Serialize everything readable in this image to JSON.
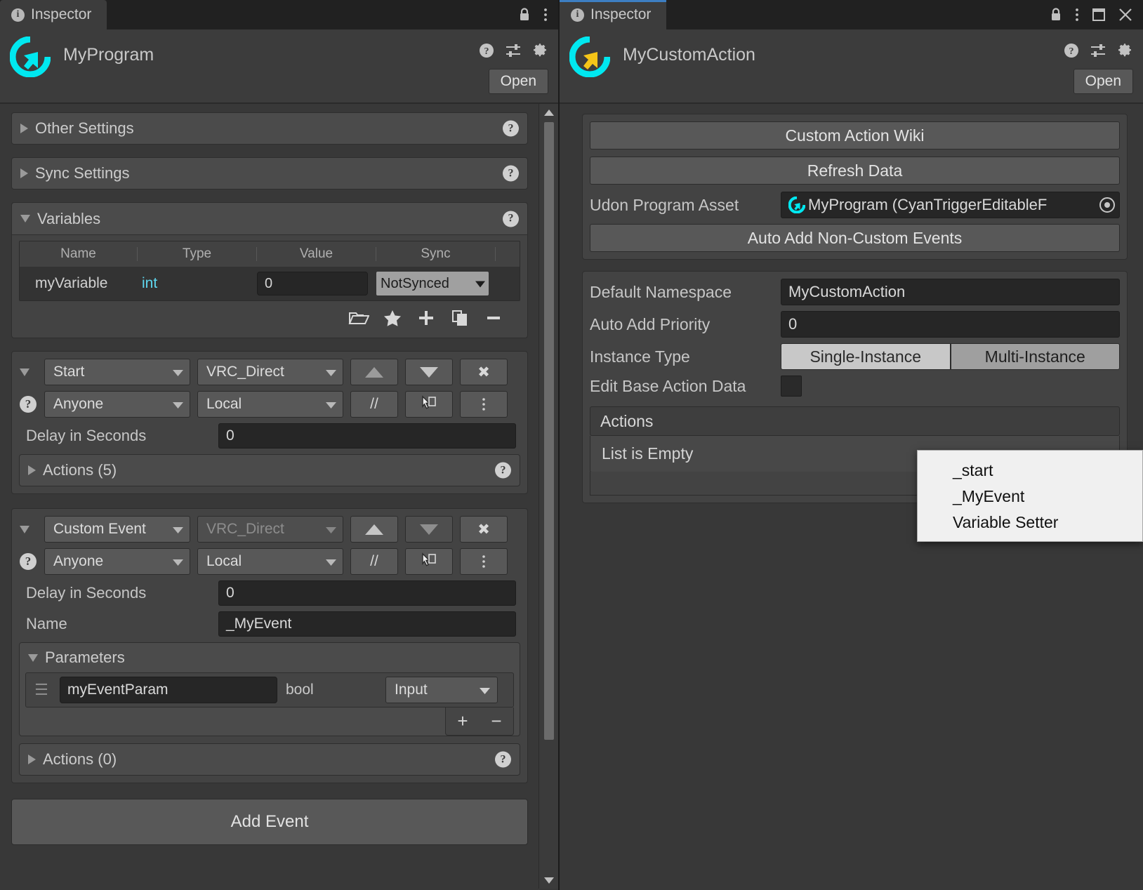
{
  "left_panel": {
    "tab": {
      "label": "Inspector",
      "icon": "info-icon"
    },
    "tabbar_icons": [
      "lock-icon",
      "kebab-menu-icon"
    ],
    "object": {
      "title": "MyProgram",
      "logo": "cyantrigger-logo-cyan",
      "icons": [
        "help-icon",
        "preset-icon",
        "gear-icon"
      ],
      "open_label": "Open"
    },
    "foldouts": [
      {
        "label": "Other Settings",
        "expanded": false,
        "help": "?"
      },
      {
        "label": "Sync Settings",
        "expanded": false,
        "help": "?"
      }
    ],
    "variables": {
      "label": "Variables",
      "expanded": true,
      "help": "?",
      "columns": [
        "Name",
        "Type",
        "Value",
        "Sync"
      ],
      "rows": [
        {
          "name": "myVariable",
          "type": "int",
          "value": "0",
          "sync": "NotSynced"
        }
      ],
      "toolbar": [
        "folder-icon",
        "star-icon",
        "plus-icon",
        "duplicate-icon",
        "minus-icon"
      ]
    },
    "events": [
      {
        "type": "Start",
        "type_dim": false,
        "source": "VRC_Direct",
        "source_dim": false,
        "up": "▲",
        "down": "▼",
        "remove": "✖",
        "who": "Anyone",
        "scope": "Local",
        "comment": "//",
        "copy": "copy-icon",
        "more": "kebab-icon",
        "delay_label": "Delay in Seconds",
        "delay_value": "0",
        "actions_label": "Actions (5)",
        "name_label": null,
        "name_value": null,
        "parameters": null
      },
      {
        "type": "Custom Event",
        "type_dim": false,
        "source": "VRC_Direct",
        "source_dim": true,
        "up": "▲",
        "down": "▼",
        "remove": "✖",
        "who": "Anyone",
        "scope": "Local",
        "comment": "//",
        "copy": "copy-icon",
        "more": "kebab-icon",
        "delay_label": "Delay in Seconds",
        "delay_value": "0",
        "actions_label": "Actions (0)",
        "name_label": "Name",
        "name_value": "_MyEvent",
        "parameters": {
          "label": "Parameters",
          "expanded": true,
          "rows": [
            {
              "name": "myEventParam",
              "type": "bool",
              "direction": "Input"
            }
          ],
          "add": "+",
          "remove": "−"
        }
      }
    ],
    "add_event_label": "Add Event",
    "scrollbar": {
      "up_arrow": "▲",
      "down_arrow": "▼"
    }
  },
  "right_panel": {
    "tab": {
      "label": "Inspector",
      "icon": "info-icon"
    },
    "tabbar_icons": [
      "lock-icon",
      "kebab-menu-icon",
      "maximize-icon",
      "close-icon"
    ],
    "object": {
      "title": "MyCustomAction",
      "logo": "cyantrigger-logo-yellow",
      "icons": [
        "help-icon",
        "preset-icon",
        "gear-icon"
      ],
      "open_label": "Open"
    },
    "buttons": {
      "wiki": "Custom Action Wiki",
      "refresh": "Refresh Data",
      "auto_add": "Auto Add Non-Custom Events"
    },
    "udon_program_asset": {
      "label": "Udon Program Asset",
      "value": "MyProgram (CyanTriggerEditableF",
      "icon": "cyantrigger-logo-cyan-small",
      "picker": "object-picker-icon"
    },
    "settings": {
      "default_namespace": {
        "label": "Default Namespace",
        "value": "MyCustomAction"
      },
      "auto_add_priority": {
        "label": "Auto Add Priority",
        "value": "0"
      },
      "instance_type": {
        "label": "Instance Type",
        "options": [
          "Single-Instance",
          "Multi-Instance"
        ],
        "selected": "Single-Instance"
      },
      "edit_base_action_data": {
        "label": "Edit Base Action Data",
        "checked": false
      }
    },
    "actions": {
      "header": "Actions",
      "empty_text": "List is Empty",
      "add": "+",
      "remove": "−"
    }
  },
  "context_menu": {
    "items": [
      "_start",
      "_MyEvent",
      "Variable Setter"
    ]
  },
  "colors": {
    "panel_bg": "#383838",
    "tab_bg": "#3c3c3c",
    "accent_blue": "#3d7ec2",
    "logo_cyan": "#00e8f0",
    "logo_yellow": "#f5c518",
    "type_cyan": "#5fd7ef",
    "menu_bg": "#f0f0f0"
  }
}
